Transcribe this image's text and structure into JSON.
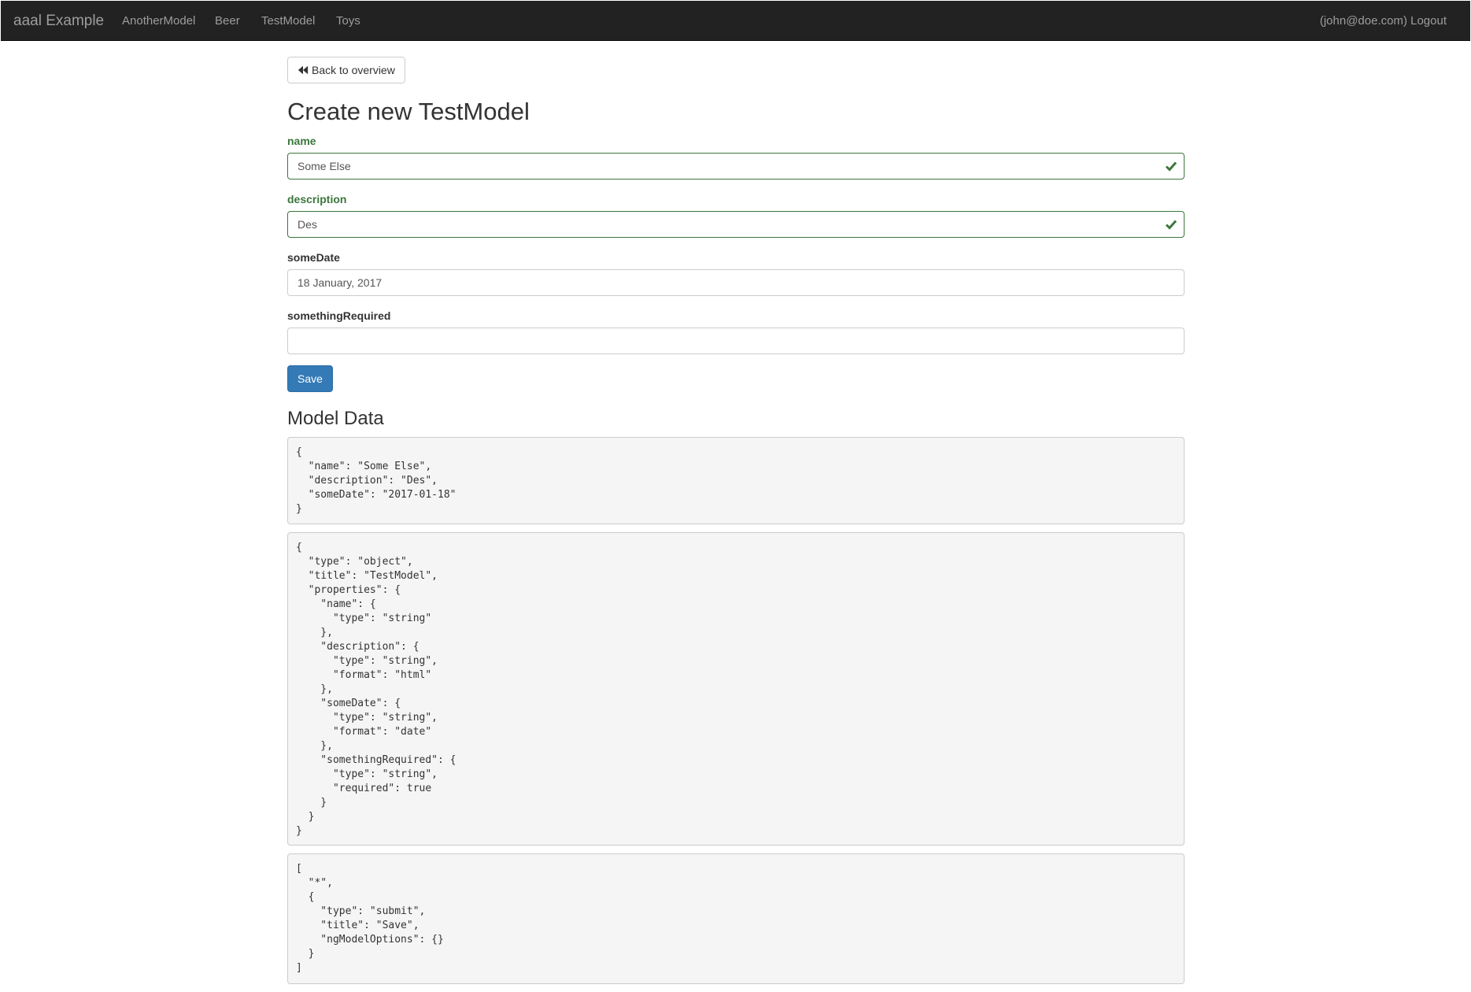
{
  "navbar": {
    "brand": "aaal Example",
    "items": [
      "AnotherModel",
      "Beer",
      "TestModel",
      "Toys"
    ],
    "user_logout": "(john@doe.com) Logout"
  },
  "back_button": {
    "label": "Back to overview",
    "icon": "backward-icon"
  },
  "page_title": "Create new TestModel",
  "form": {
    "name": {
      "label": "name",
      "value": "Some Else",
      "status": "valid"
    },
    "description": {
      "label": "description",
      "value": "Des",
      "status": "valid"
    },
    "someDate": {
      "label": "someDate",
      "value": "18 January, 2017"
    },
    "somethingRequired": {
      "label": "somethingRequired",
      "value": ""
    },
    "save_label": "Save"
  },
  "section_title": "Model Data",
  "code_blocks": {
    "model": "{\n  \"name\": \"Some Else\",\n  \"description\": \"Des\",\n  \"someDate\": \"2017-01-18\"\n}",
    "schema": "{\n  \"type\": \"object\",\n  \"title\": \"TestModel\",\n  \"properties\": {\n    \"name\": {\n      \"type\": \"string\"\n    },\n    \"description\": {\n      \"type\": \"string\",\n      \"format\": \"html\"\n    },\n    \"someDate\": {\n      \"type\": \"string\",\n      \"format\": \"date\"\n    },\n    \"somethingRequired\": {\n      \"type\": \"string\",\n      \"required\": true\n    }\n  }\n}",
    "form": "[\n  \"*\",\n  {\n    \"type\": \"submit\",\n    \"title\": \"Save\",\n    \"ngModelOptions\": {}\n  }\n]"
  },
  "colors": {
    "navbar_bg": "#222222",
    "nav_text": "#9d9d9d",
    "success": "#3c763d",
    "primary": "#337ab7",
    "code_bg": "#f5f5f5"
  }
}
